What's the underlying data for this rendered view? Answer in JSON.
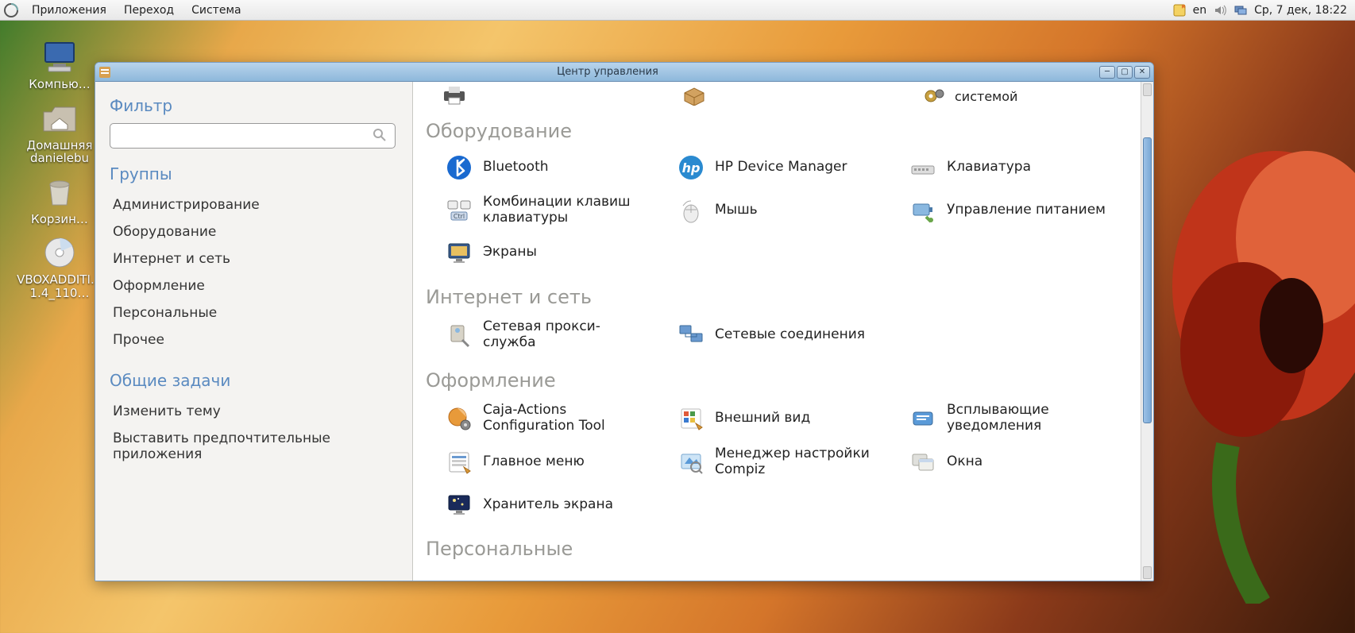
{
  "panel": {
    "menus": [
      "Приложения",
      "Переход",
      "Система"
    ],
    "lang": "en",
    "clock": "Ср,  7 дек, 18:22"
  },
  "desktop": {
    "items": [
      {
        "label": "Компью…"
      },
      {
        "label": "Домашняя\ndanielebu"
      },
      {
        "label": "Корзин…"
      },
      {
        "label": "VBOXADDITI…\n1.4_110…"
      }
    ]
  },
  "window": {
    "title": "Центр управления",
    "sidebar": {
      "filter_heading": "Фильтр",
      "filter_placeholder": "",
      "groups_heading": "Группы",
      "groups": [
        "Администрирование",
        "Оборудование",
        "Интернет и сеть",
        "Оформление",
        "Персональные",
        "Прочее"
      ],
      "tasks_heading": "Общие задачи",
      "tasks": [
        "Изменить тему",
        "Выставить предпочтительные приложения"
      ]
    },
    "content": {
      "top_cut": [
        {
          "label": "",
          "icon": "printer-icon"
        },
        {
          "label": "",
          "icon": "box-icon"
        },
        {
          "label": "системой",
          "icon": "gear-icon"
        }
      ],
      "sections": [
        {
          "title": "Оборудование",
          "items": [
            {
              "label": "Bluetooth",
              "icon": "bluetooth-icon"
            },
            {
              "label": "HP Device Manager",
              "icon": "hp-icon"
            },
            {
              "label": "Клавиатура",
              "icon": "keyboard-icon"
            },
            {
              "label": "Комбинации клавиш клавиатуры",
              "icon": "shortcut-icon"
            },
            {
              "label": "Мышь",
              "icon": "mouse-icon"
            },
            {
              "label": "Управление питанием",
              "icon": "power-icon"
            },
            {
              "label": "Экраны",
              "icon": "display-icon"
            }
          ]
        },
        {
          "title": "Интернет и сеть",
          "items": [
            {
              "label": "Сетевая прокси-служба",
              "icon": "proxy-icon"
            },
            {
              "label": "Сетевые соединения",
              "icon": "network-icon"
            }
          ]
        },
        {
          "title": "Оформление",
          "items": [
            {
              "label": "Caja-Actions Configuration Tool",
              "icon": "caja-icon"
            },
            {
              "label": "Внешний вид",
              "icon": "appearance-icon"
            },
            {
              "label": "Всплывающие уведомления",
              "icon": "notify-icon"
            },
            {
              "label": "Главное меню",
              "icon": "mainmenu-icon"
            },
            {
              "label": "Менеджер настройки Compiz",
              "icon": "compiz-icon"
            },
            {
              "label": "Окна",
              "icon": "windows-icon"
            },
            {
              "label": "Хранитель экрана",
              "icon": "screensaver-icon"
            }
          ]
        },
        {
          "title": "Персональные",
          "items": []
        }
      ]
    }
  }
}
